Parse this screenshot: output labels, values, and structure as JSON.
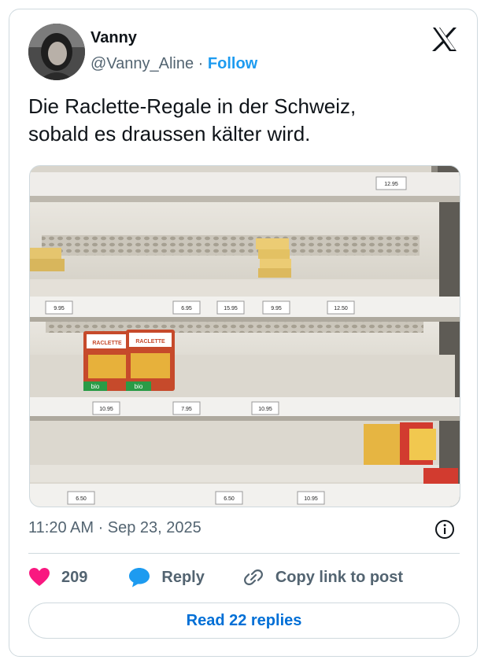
{
  "author": {
    "display_name": "Vanny",
    "handle": "@Vanny_Aline",
    "separator": " · ",
    "follow_label": "Follow"
  },
  "tweet": {
    "text_line1": "Die Raclette-Regale in der Schweiz,",
    "text_line2": "sobald es draussen kälter wird.",
    "timestamp": "11:20 AM · Sep 23, 2025"
  },
  "media": {
    "price_labels": [
      "12.95",
      "9.95",
      "6.95",
      "15.95",
      "9.95",
      "12.50",
      "10.95",
      "7.95",
      "10.95",
      "6.50",
      "6.50",
      "10.95"
    ],
    "package_text": "RACLETTE",
    "bio_label": "bio"
  },
  "actions": {
    "like_count": "209",
    "reply_label": "Reply",
    "copy_label": "Copy link to post",
    "read_replies_label": "Read 22 replies"
  },
  "colors": {
    "like": "#f91880",
    "reply": "#1d9bf0",
    "follow": "#1d9bf0",
    "read_replies": "#006fd6",
    "secondary_text": "#536471"
  },
  "icons": [
    "x-logo-icon",
    "info-icon",
    "heart-icon",
    "reply-bubble-icon",
    "link-icon"
  ]
}
